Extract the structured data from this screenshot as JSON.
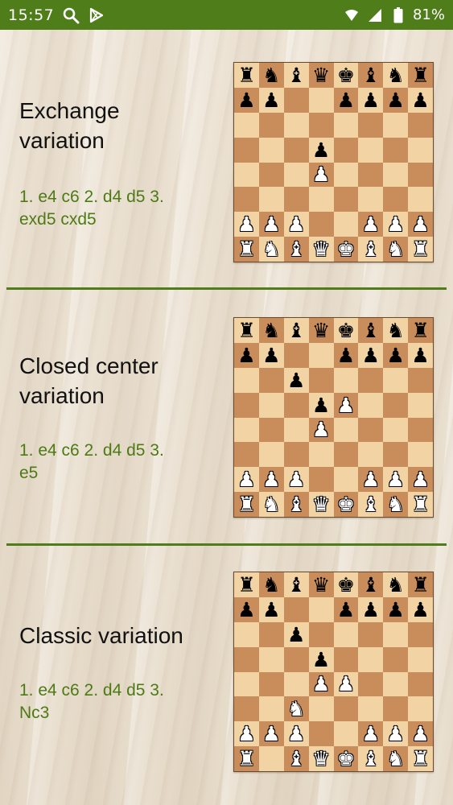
{
  "status_bar": {
    "time": "15:57",
    "left_icons": [
      "search-icon",
      "play-store-icon",
      "do-not-disturb-moon-icon"
    ],
    "right_icons": [
      "wifi-icon",
      "signal-icon",
      "battery-icon"
    ],
    "battery": "81%"
  },
  "colors": {
    "status_bar": "#4f7d1a",
    "moves_text": "#4c7a14",
    "divider": "#4f7d1a",
    "light_square": "#f1d3a4",
    "dark_square": "#c88d5b"
  },
  "variations": [
    {
      "title_lines": [
        "Exchange",
        "variation"
      ],
      "moves_lines": [
        "1. e4 c6 2. d4 d5 3.",
        "exd5 cxd5"
      ],
      "board": [
        "rnbqkbnr",
        "pp..ppp p",
        "........",
        "...p....",
        "...P....",
        "........",
        "PPP..PPP",
        "RNBQKBNR"
      ]
    },
    {
      "title_lines": [
        "Closed center",
        "variation"
      ],
      "moves_lines": [
        "1. e4 c6 2. d4 d5 3.",
        "e5"
      ],
      "board": [
        "rnbqkbnr",
        "pp..pppp",
        "..p.....",
        "...pP...",
        "...P....",
        "........",
        "PPP..PPP",
        "RNBQKBNR"
      ]
    },
    {
      "title_lines": [
        "Classic variation"
      ],
      "moves_lines": [
        "1. e4 c6 2. d4 d5 3.",
        "Nc3"
      ],
      "board": [
        "rnbqkbnr",
        "pp..pppp",
        "..p.....",
        "...p....",
        "...PP...",
        "..N.....",
        "PPP..PPP",
        "R.BQKBNR"
      ]
    }
  ]
}
